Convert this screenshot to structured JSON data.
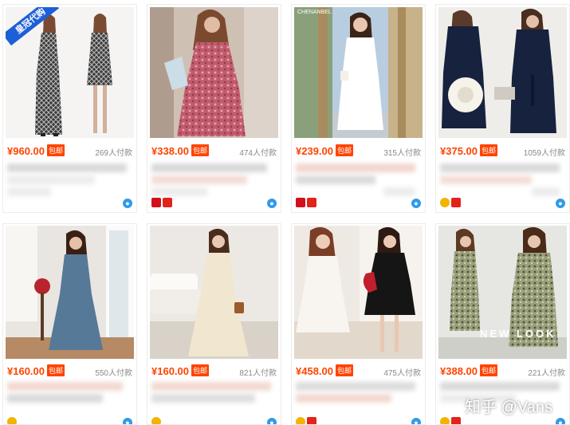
{
  "products": [
    {
      "price": "¥960.00",
      "badge": "包邮",
      "sales": "269人付款"
    },
    {
      "price": "¥338.00",
      "badge": "包邮",
      "sales": "474人付款"
    },
    {
      "price": "¥239.00",
      "badge": "包邮",
      "sales": "315人付款"
    },
    {
      "price": "¥375.00",
      "badge": "包邮",
      "sales": "1059人付款"
    },
    {
      "price": "¥160.00",
      "badge": "包邮",
      "sales": "550人付款"
    },
    {
      "price": "¥160.00",
      "badge": "包邮",
      "sales": "821人付款"
    },
    {
      "price": "¥458.00",
      "badge": "包邮",
      "sales": "475人付款"
    },
    {
      "price": "¥388.00",
      "badge": "包邮",
      "sales": "221人付款"
    }
  ],
  "ribbon_label": "皇冠代购",
  "image_texts": {
    "chenanbel": "CHENANBEL",
    "newlook": "NEW LOOK"
  },
  "watermark": "知乎 @Vans",
  "colors": {
    "price": "#ff4400",
    "badge_bg": "#ff4400",
    "wangwang": "#2f9bea",
    "ribbon": "#1d5fd6"
  },
  "icons": {
    "shop": "tmall-shop-icon",
    "gold": "crown-level-icon",
    "chat": "wangwang-chat-icon"
  }
}
